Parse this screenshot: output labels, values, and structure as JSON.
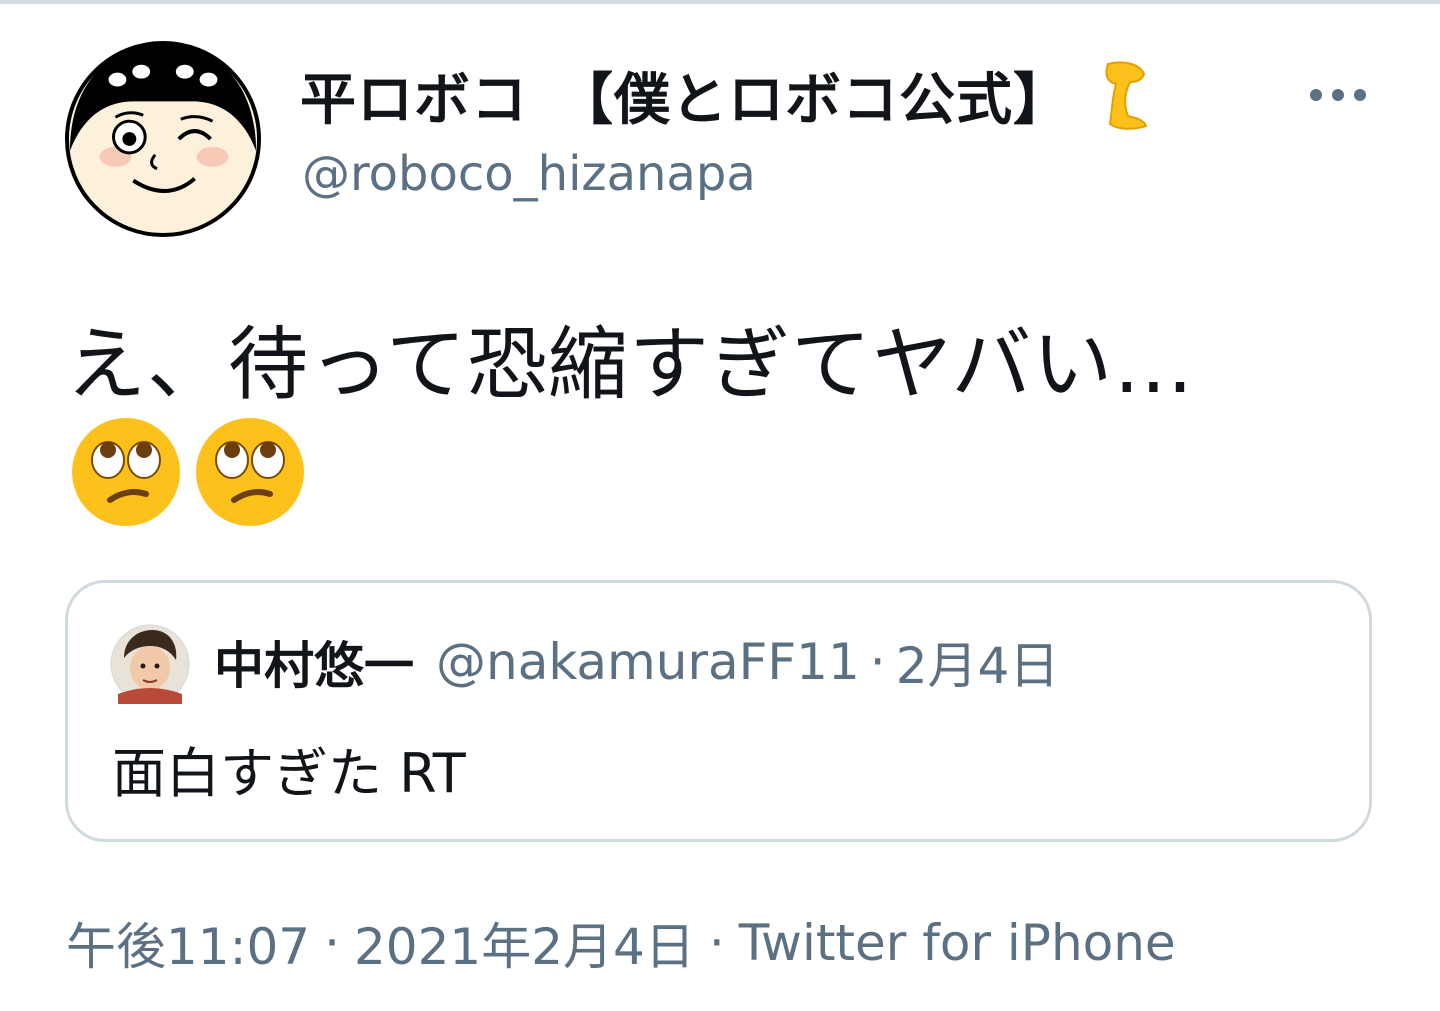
{
  "tweet": {
    "author": {
      "display_name": "平ロボコ　【僕とロボコ公式】",
      "handle": "@roboco_hizanapa",
      "name_emoji": "leg-icon"
    },
    "more_icon": "more-horizontal-icon",
    "text": "え、待って恐縮すぎてヤバい…",
    "emojis": [
      "face-with-rolling-eyes-icon",
      "face-with-rolling-eyes-icon"
    ],
    "quoted": {
      "display_name": "中村悠一",
      "handle": "@nakamuraFF11",
      "separator": "·",
      "date": "2月4日",
      "text": "面白すぎた RT"
    },
    "meta": {
      "time": "午後11:07",
      "separator": "·",
      "date": "2021年2月4日",
      "source": "Twitter for iPhone"
    }
  },
  "colors": {
    "text_primary": "#111418",
    "text_secondary": "#5b7083",
    "border": "#cfd9de",
    "emoji_yellow": "#fcc21b"
  }
}
